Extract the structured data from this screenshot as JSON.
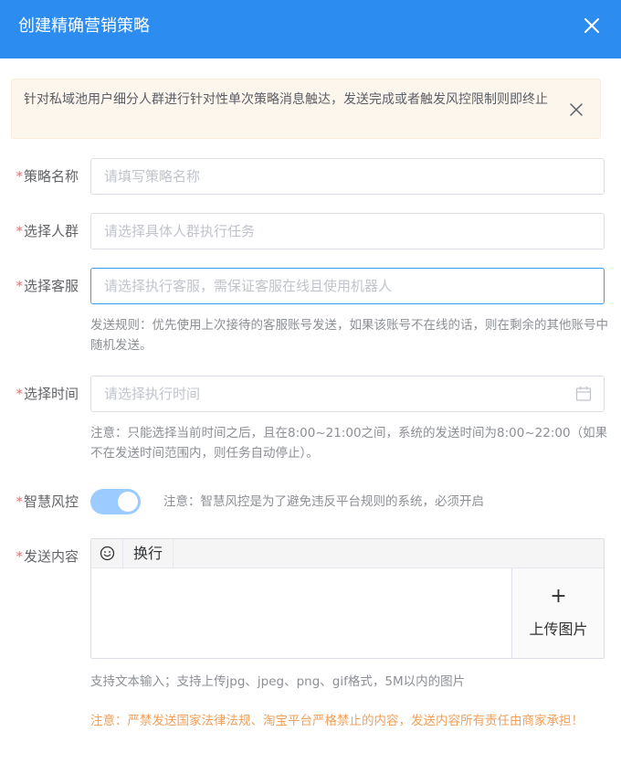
{
  "dialog": {
    "title": "创建精确营销策略",
    "close_icon": "close-icon"
  },
  "alert": {
    "text": "针对私域池用户细分人群进行针对性单次策略消息触达，发送完成或者触发风控限制则即终止",
    "close_icon": "close-icon"
  },
  "form": {
    "required_mark": "*",
    "strategy_name": {
      "label": "策略名称",
      "placeholder": "请填写策略名称"
    },
    "crowd": {
      "label": "选择人群",
      "placeholder": "请选择具体人群执行任务"
    },
    "service": {
      "label": "选择客服",
      "placeholder": "请选择执行客服，需保证客服在线且使用机器人",
      "hint": "发送规则：优先使用上次接待的客服账号发送，如果该账号不在线的话，则在剩余的其他账号中随机发送。"
    },
    "time": {
      "label": "选择时间",
      "placeholder": "请选择执行时间",
      "icon": "calendar-icon",
      "hint": "注意：只能选择当前时间之后，且在8:00~21:00之间，系统的发送时间为8:00~22:00（如果不在发送时间范围内，则任务自动停止）。"
    },
    "risk_control": {
      "label": "智慧风控",
      "enabled": true,
      "hint": "注意：智慧风控是为了避免违反平台规则的系统，必须开启"
    },
    "content": {
      "label": "发送内容",
      "toolbar": {
        "emoji_icon": "smiley-icon",
        "newline_label": "换行"
      },
      "upload": {
        "plus": "+",
        "label": "上传图片"
      },
      "hint": "支持文本输入；支持上传jpg、jpeg、png、gif格式，5M以内的图片",
      "warning": "注意：严禁发送国家法律法规、淘宝平台严格禁止的内容，发送内容所有责任由商家承担！"
    }
  },
  "colors": {
    "header_bg": "#2d8cf0",
    "alert_bg": "#fdf6ec",
    "required": "#f56c6c",
    "switch_on": "#9ccbff",
    "focus_border": "#3ba1ee",
    "warning_text": "#f0a05a"
  }
}
